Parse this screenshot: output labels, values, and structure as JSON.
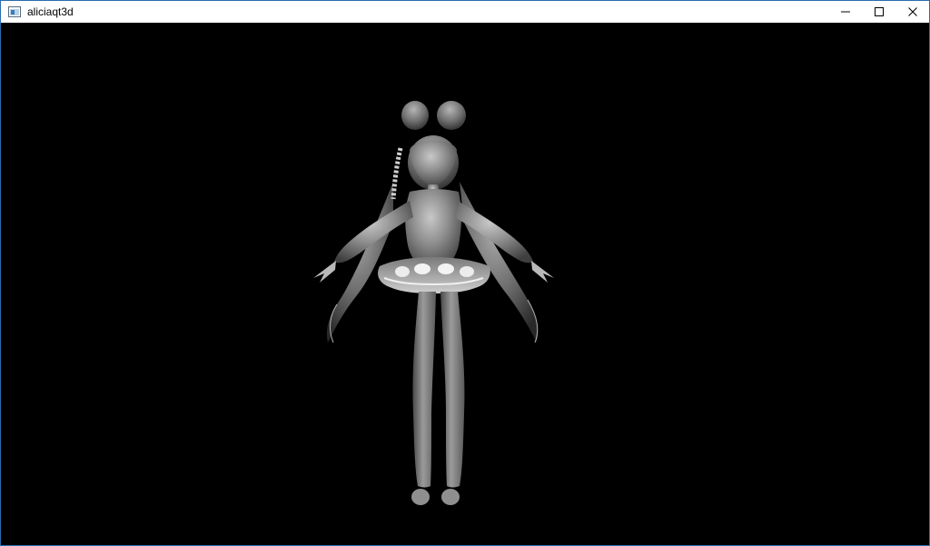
{
  "window": {
    "title": "aliciaqt3d",
    "controls": {
      "minimize_icon": "minimize-icon",
      "maximize_icon": "maximize-icon",
      "close_icon": "close-icon"
    }
  },
  "viewport": {
    "background": "#000000",
    "content": "3d-character-model"
  }
}
